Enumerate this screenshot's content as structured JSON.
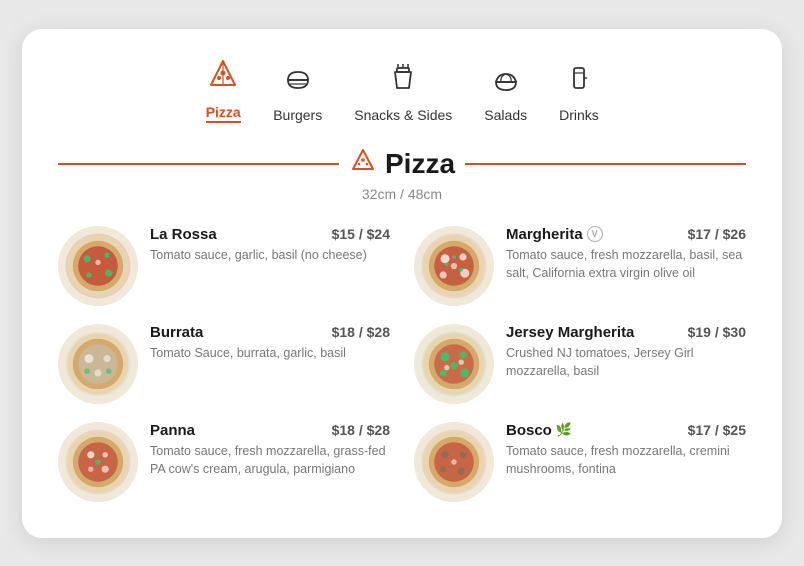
{
  "nav": {
    "items": [
      {
        "id": "pizza",
        "label": "Pizza",
        "active": true
      },
      {
        "id": "burgers",
        "label": "Burgers",
        "active": false
      },
      {
        "id": "snacks",
        "label": "Snacks & Sides",
        "active": false
      },
      {
        "id": "salads",
        "label": "Salads",
        "active": false
      },
      {
        "id": "drinks",
        "label": "Drinks",
        "active": false
      }
    ]
  },
  "section": {
    "title": "Pizza",
    "subtitle": "32cm / 48cm"
  },
  "menu": [
    {
      "col": "left",
      "items": [
        {
          "name": "La Rossa",
          "price": "$15 / $24",
          "desc": "Tomato sauce, garlic, basil (no cheese)",
          "badge": null,
          "leaf": false
        },
        {
          "name": "Burrata",
          "price": "$18 / $28",
          "desc": "Tomato Sauce, burrata, garlic, basil",
          "badge": null,
          "leaf": false
        },
        {
          "name": "Panna",
          "price": "$18 / $28",
          "desc": "Tomato sauce, fresh mozzarella, grass-fed PA cow's cream, arugula, parmigiano",
          "badge": null,
          "leaf": false
        }
      ]
    },
    {
      "col": "right",
      "items": [
        {
          "name": "Margherita",
          "price": "$17 / $26",
          "desc": "Tomato sauce, fresh mozzarella, basil, sea salt, California extra virgin olive oil",
          "badge": "V",
          "leaf": false
        },
        {
          "name": "Jersey Margherita",
          "price": "$19 / $30",
          "desc": "Crushed NJ tomatoes, Jersey Girl mozzarella, basil",
          "badge": null,
          "leaf": false
        },
        {
          "name": "Bosco",
          "price": "$17 / $25",
          "desc": "Tomato sauce, fresh mozzarella, cremini mushrooms, fontina",
          "badge": null,
          "leaf": true
        }
      ]
    }
  ]
}
